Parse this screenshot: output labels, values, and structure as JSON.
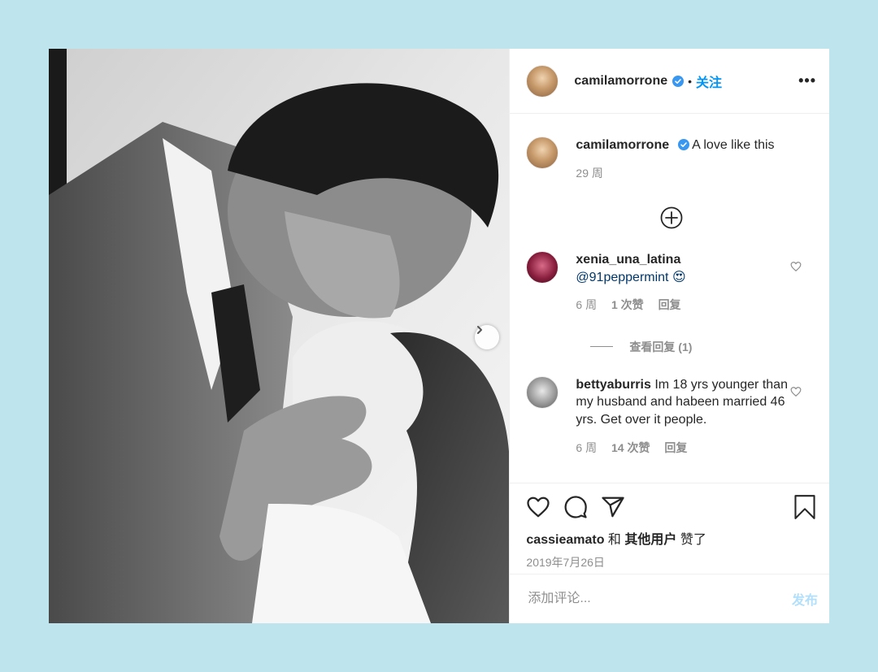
{
  "post": {
    "photo_icon": "post-photo",
    "next_icon": "chevron-right-icon"
  },
  "header": {
    "username": "camilamorrone",
    "dot": "•",
    "follow_label": "关注",
    "more_label": "•••"
  },
  "caption": {
    "username": "camilamorrone",
    "text": "A love like this",
    "time": "29 周"
  },
  "comments": [
    {
      "username": "xenia_una_latina",
      "text": "@91peppermint 😍",
      "time": "6 周",
      "likes": "1 次赞",
      "reply_label": "回复",
      "view_replies": "查看回复 (1)"
    },
    {
      "username": "bettyaburris",
      "text": "Im 18 yrs younger than my husband and habeen married 46 yrs. Get over it people.",
      "time": "6 周",
      "likes": "14 次赞",
      "reply_label": "回复"
    }
  ],
  "actions": {
    "liker": "cassieamato",
    "and": "和",
    "others": "其他用户",
    "liked": "赞了",
    "date": "2019年7月26日"
  },
  "add_comment": {
    "placeholder": "添加评论...",
    "post_label": "发布"
  },
  "colors": {
    "background": "#bee5ee",
    "link": "#0095f6",
    "muted": "#8e8e8e",
    "post_disabled": "#b2dffc"
  }
}
